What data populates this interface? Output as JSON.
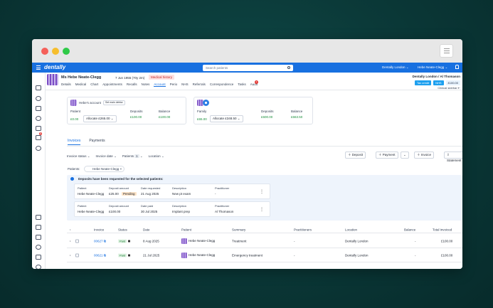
{
  "app": {
    "logo": "dentally",
    "search_placeholder": "Search patients",
    "location": "Dentally London",
    "user": "Hebe Neate-Clegg"
  },
  "patient": {
    "name": "Ms Hebe Neate-Clegg",
    "dob": "7 Jun 1955 (70y 2m)",
    "medical_history": "Medical history"
  },
  "tabs": [
    "Details",
    "Medical",
    "Chart",
    "Appointments",
    "Recalls",
    "Notes",
    "Account",
    "Perio",
    "NHS",
    "Referrals",
    "Correspondence",
    "Tasks",
    "Audit"
  ],
  "tasks_count": "4",
  "header_right": {
    "practice": "Dentally London / Al Thomason",
    "tax_credit": "Tax credit",
    "nhs": "NHS",
    "amount": "£100.00",
    "clinical_sidebar": "Clinical sidebar"
  },
  "sidebar_badge": "5",
  "account": {
    "title": "Hebe's account",
    "set_main": "Set main debtor",
    "patient_label": "Patient",
    "patient_value": "£0.00",
    "allocate": "Allocate £265.00",
    "deposits_label": "Deposits",
    "deposits_value": "£100.00",
    "balance_label": "Balance",
    "balance_value": "£100.00"
  },
  "family": {
    "label": "Family",
    "value": "£65.00",
    "allocate": "Allocate £348.50",
    "deposits_label": "Deposits",
    "deposits_value": "£600.00",
    "balance_label": "Balance",
    "balance_value": "£663.50"
  },
  "subtabs": [
    "Invoices",
    "Payments"
  ],
  "filters": {
    "status": "Invoice status",
    "date": "Invoice date",
    "patients": "Patients",
    "patients_count": "1",
    "location": "Location"
  },
  "actions": {
    "deposit": "Deposit",
    "payment": "Payment",
    "invoice": "Invoice",
    "statement": "Statement"
  },
  "patients_chip": {
    "label": "Patients:",
    "name": "Hebe Neate-Clegg"
  },
  "deposits_info": {
    "title": "Deposits have been requested for the selected patients:",
    "cards": [
      {
        "h": [
          "Patient",
          "Deposit amount",
          "Date requested",
          "Description",
          "Practitioner"
        ],
        "v": [
          "Hebe Neate-Clegg",
          "£25.00",
          "21 Aug 2025",
          "New pt exam",
          "-"
        ],
        "status": "Pending"
      },
      {
        "h": [
          "Patient",
          "Deposit amount",
          "Date paid",
          "Description",
          "Practitioner"
        ],
        "v": [
          "Hebe Neate-Clegg",
          "£100.00",
          "30 Jul 2025",
          "Implant prep",
          "Al Thomason"
        ],
        "status": ""
      }
    ]
  },
  "table": {
    "headers": [
      "Invoice",
      "Status",
      "Date",
      "Patient",
      "Summary",
      "Practitioners",
      "Location",
      "Balance",
      "Total invoiced"
    ],
    "rows": [
      {
        "invoice": "00627",
        "status": "Paid",
        "date": "8 Aug 2025",
        "patient": "Hebe Neate-Clegg",
        "summary": "Treatment",
        "practitioners": "-",
        "location": "Dentally London",
        "balance": "-",
        "total": "£100.00"
      },
      {
        "invoice": "00621",
        "status": "Paid",
        "date": "21 Jul 2025",
        "patient": "Hebe Neate-Clegg",
        "summary": "Emergency treatment",
        "practitioners": "-",
        "location": "Dentally London",
        "balance": "-",
        "total": "£100.00"
      }
    ]
  }
}
